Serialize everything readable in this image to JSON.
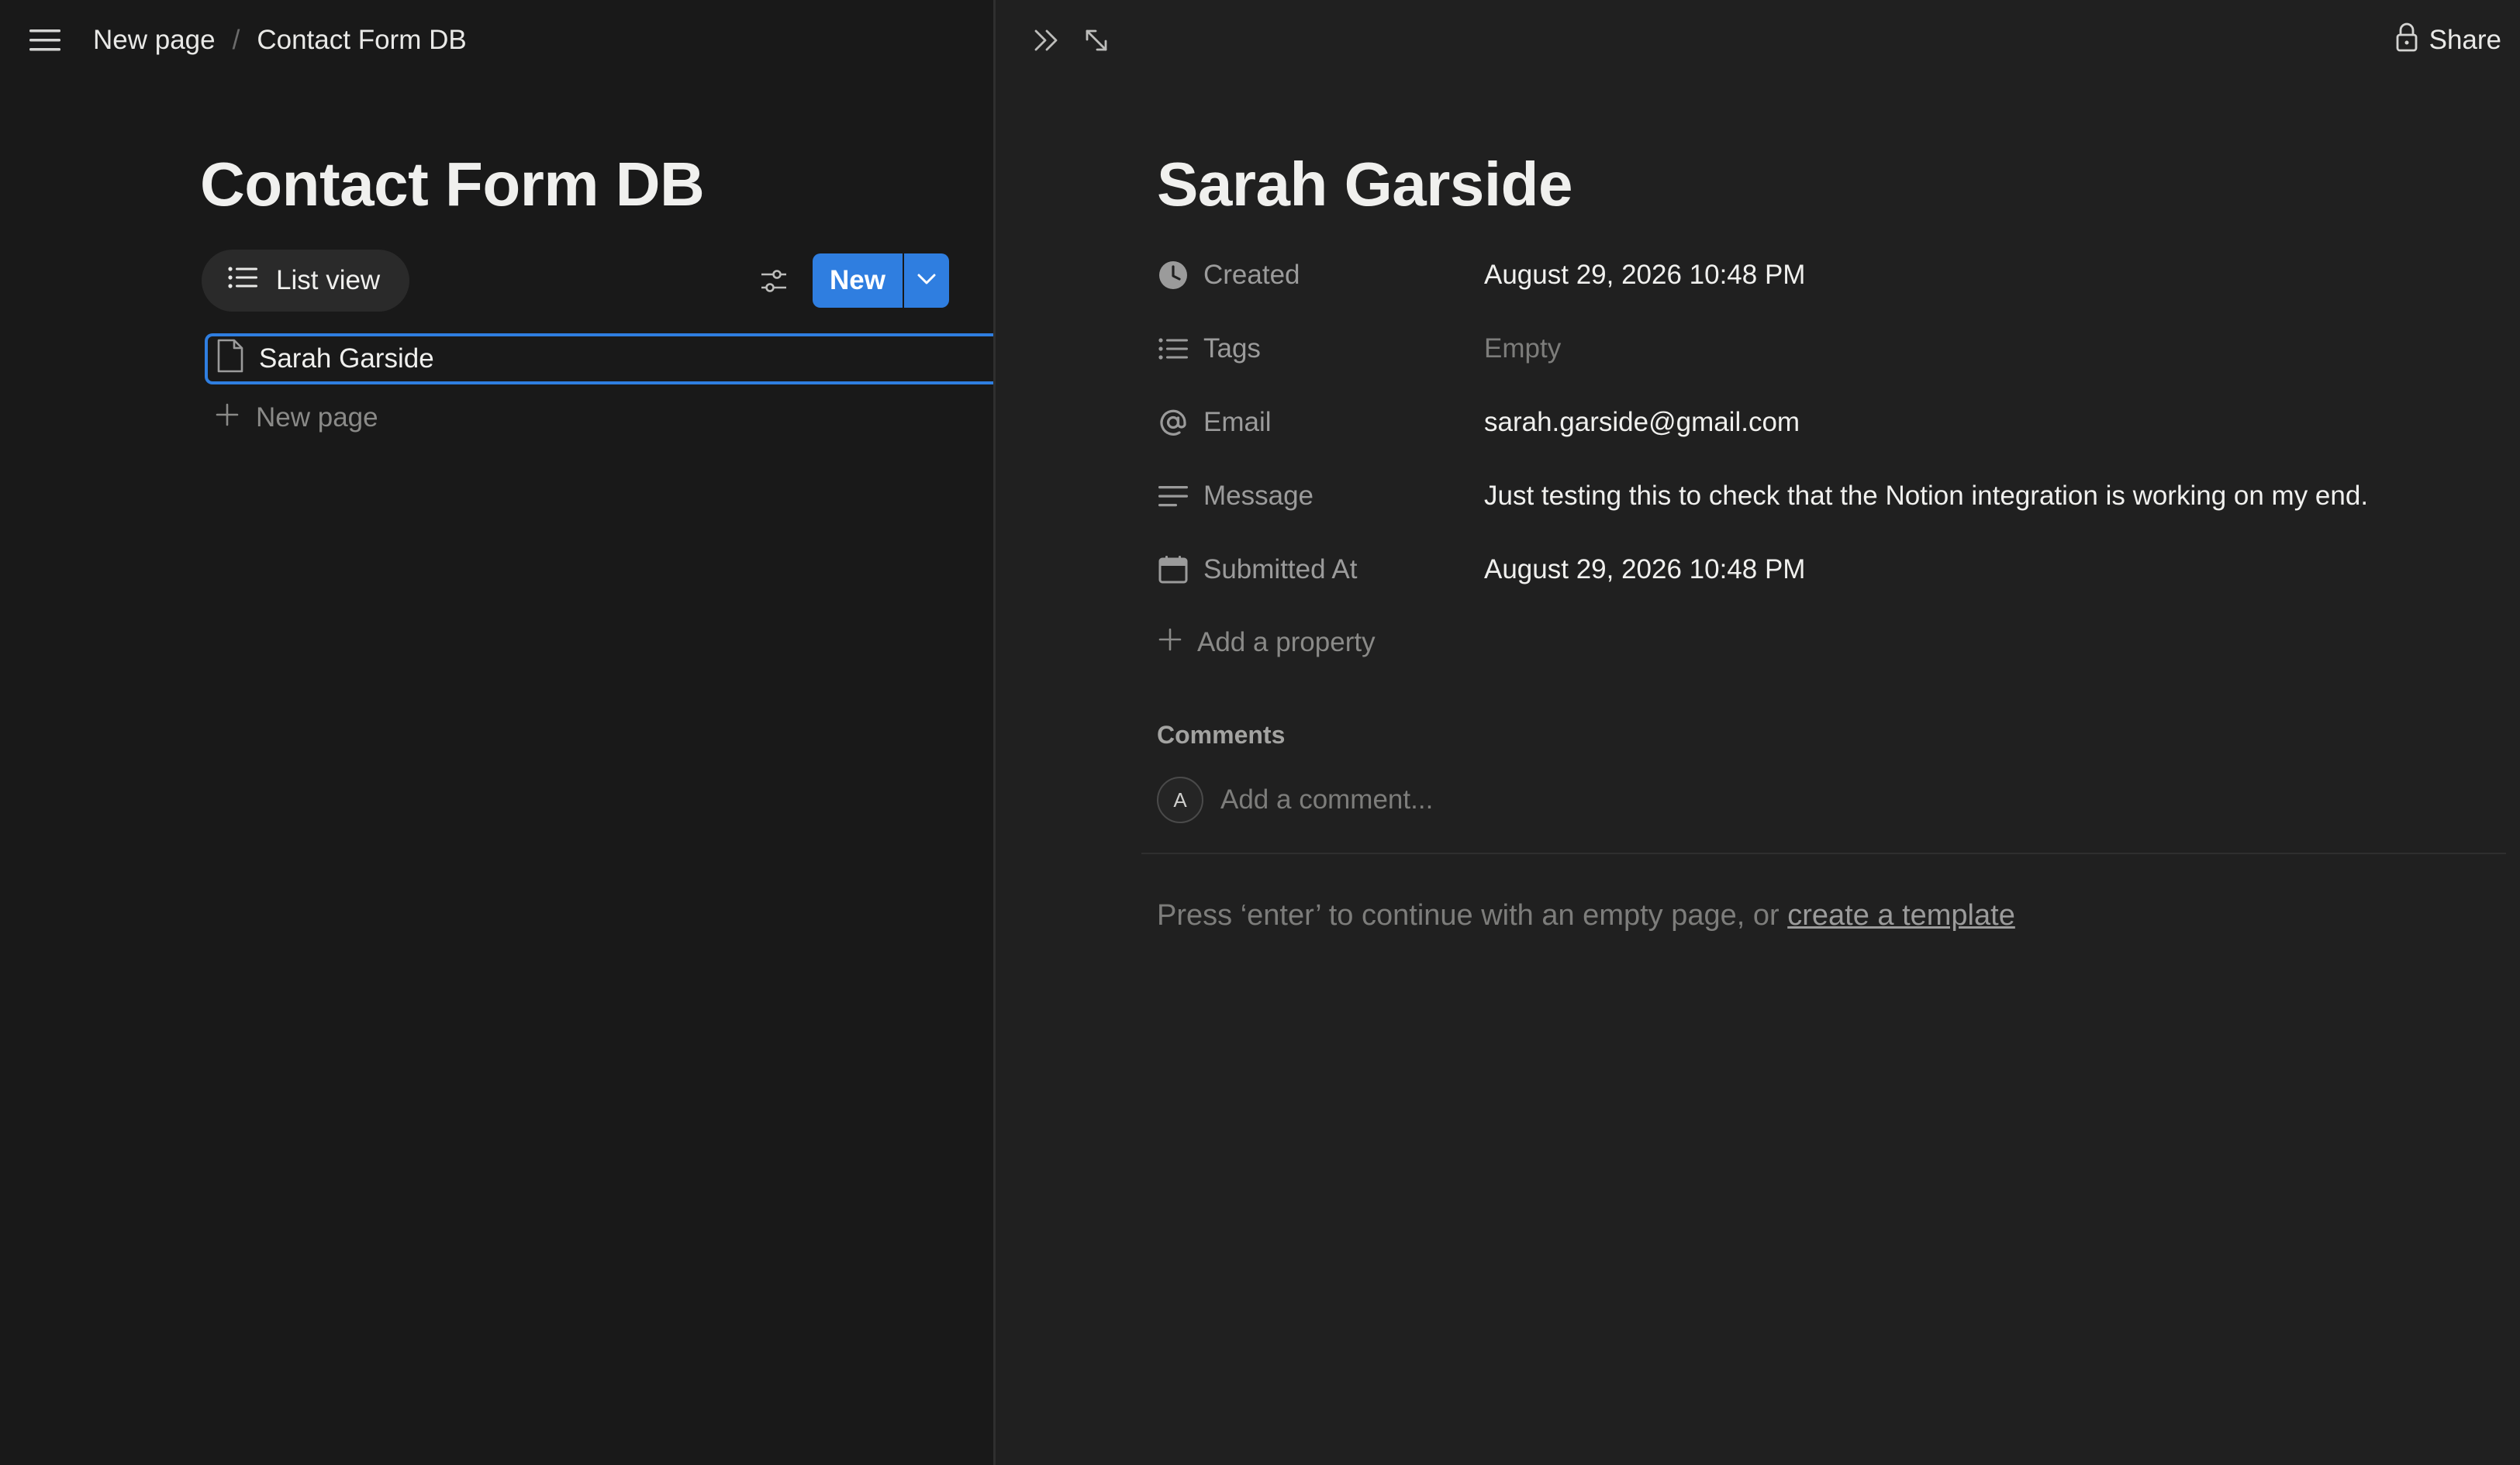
{
  "header": {
    "breadcrumb": [
      "New page",
      "Contact Form DB"
    ],
    "breadcrumb_separator": "/"
  },
  "database": {
    "title": "Contact Form DB",
    "view_label": "List view",
    "new_label": "New",
    "items": [
      "Sarah Garside"
    ],
    "new_page_label": "New page"
  },
  "page": {
    "title": "Sarah Garside",
    "share_label": "Share",
    "properties": [
      {
        "icon": "clock-icon",
        "name": "Created",
        "value": "August 29, 2026 10:48 PM",
        "empty": false
      },
      {
        "icon": "list-icon",
        "name": "Tags",
        "value": "Empty",
        "empty": true
      },
      {
        "icon": "at-icon",
        "name": "Email",
        "value": "sarah.garside@gmail.com",
        "empty": false
      },
      {
        "icon": "text-lines-icon",
        "name": "Message",
        "value": "Just testing this to check that the Notion integration is working on my end.",
        "empty": false
      },
      {
        "icon": "calendar-icon",
        "name": "Submitted At",
        "value": "August 29, 2026 10:48 PM",
        "empty": false
      }
    ],
    "add_property_label": "Add a property",
    "comments_label": "Comments",
    "avatar_initial": "A",
    "comment_placeholder": "Add a comment...",
    "hint_text": "Press ‘enter’ to continue with an empty page, or ",
    "hint_link": "create a template"
  },
  "colors": {
    "accent": "#2f7ee0",
    "background_left": "#191919",
    "background_right": "#202020"
  }
}
